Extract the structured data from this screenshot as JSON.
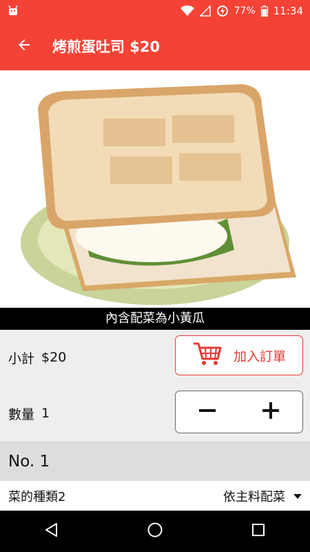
{
  "status_bar": {
    "battery_percent": "77%",
    "time": "11:34"
  },
  "app_bar": {
    "title": "烤煎蛋吐司 $20"
  },
  "product": {
    "caption": "內含配菜為小黃瓜"
  },
  "subtotal": {
    "label": "小計",
    "amount": "$20"
  },
  "add_to_order": {
    "label": "加入訂單"
  },
  "quantity": {
    "label": "數量",
    "value": "1"
  },
  "item_section": {
    "title": "No. 1"
  },
  "side_dish": {
    "label": "菜的種類2",
    "selected": "依主料配菜"
  },
  "colors": {
    "primary": "#f44336",
    "accent": "#e53935",
    "caption_bg": "#000000"
  }
}
